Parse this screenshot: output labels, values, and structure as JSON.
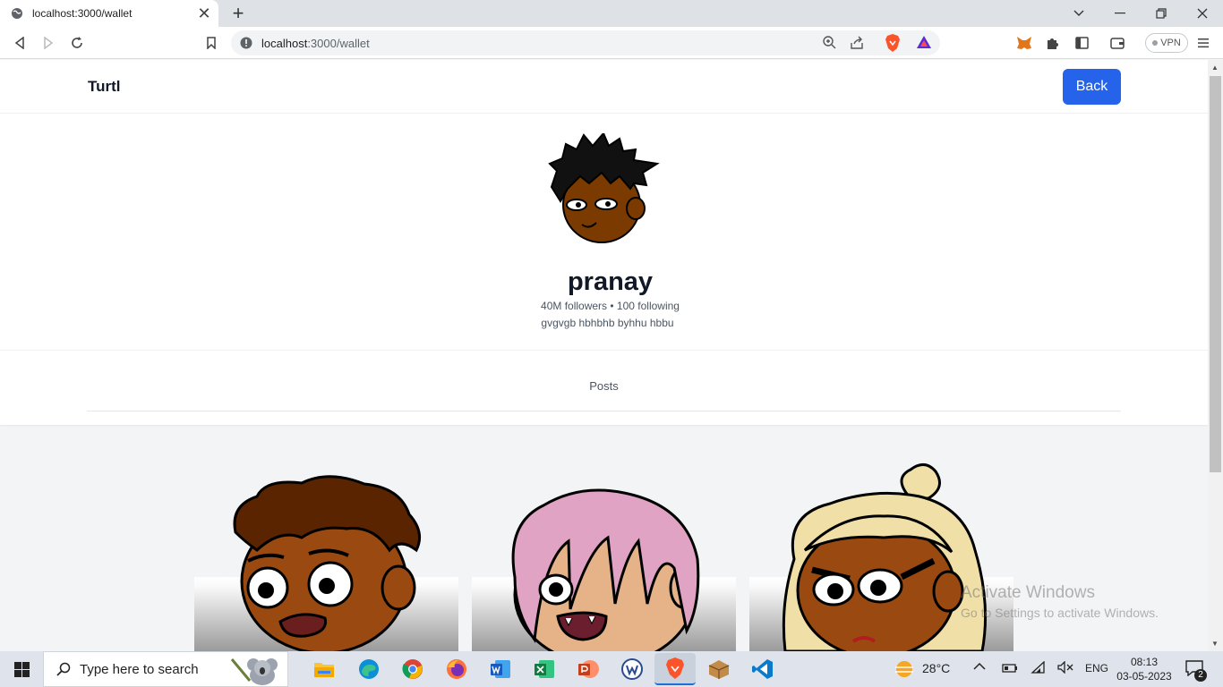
{
  "browser": {
    "tab_title": "localhost:3000/wallet",
    "url_host": "localhost",
    "url_rest": ":3000/wallet",
    "vpn_label": "VPN"
  },
  "app": {
    "brand": "Turtl",
    "back_label": "Back"
  },
  "profile": {
    "username": "pranay",
    "stats": "40M followers • 100 following",
    "bio": "gvgvgb hbhbhb byhhu hbbu"
  },
  "tabs": {
    "posts_label": "Posts"
  },
  "posts": [
    {
      "character": "brown-hair-boy"
    },
    {
      "character": "pink-hair-girl"
    },
    {
      "character": "blonde-bun-girl"
    }
  ],
  "watermark": {
    "line1": "Activate Windows",
    "line2": "Go to Settings to activate Windows."
  },
  "taskbar": {
    "search_placeholder": "Type here to search",
    "weather": "28°C",
    "language": "ENG",
    "time": "08:13",
    "date": "03-05-2023",
    "notification_count": "2"
  },
  "colors": {
    "accent": "#2563eb",
    "page_bg": "#f3f4f6"
  }
}
